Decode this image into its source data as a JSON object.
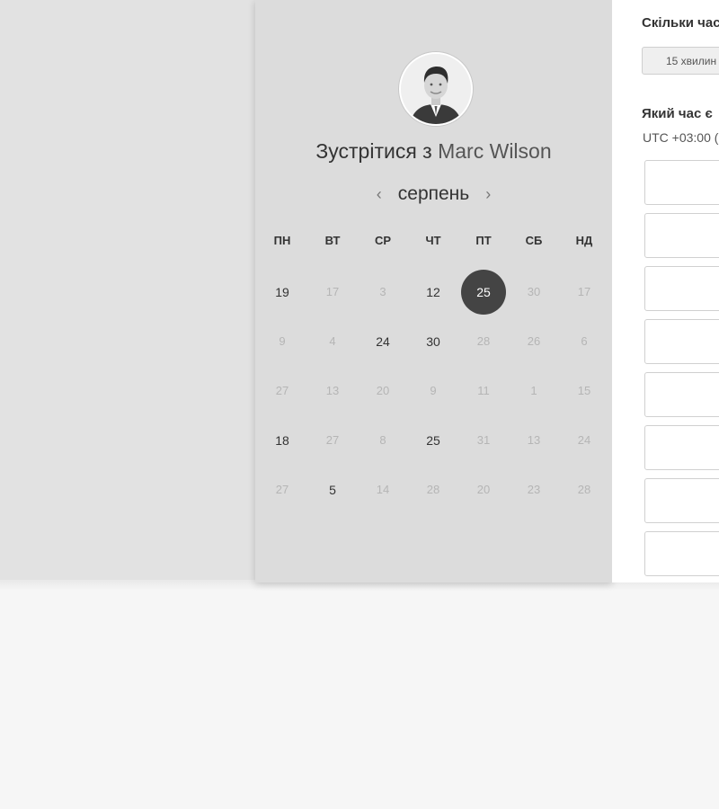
{
  "booking": {
    "title_prefix": "Зустрітися з",
    "host_name": "Marc Wilson",
    "avatar_icon": "person-photo",
    "month": "серпень",
    "prev_icon": "chevron-left-icon",
    "next_icon": "chevron-right-icon",
    "weekdays": [
      "ПН",
      "ВТ",
      "СР",
      "ЧТ",
      "ПТ",
      "СБ",
      "НД"
    ],
    "weeks": [
      [
        {
          "d": "19",
          "s": "active"
        },
        {
          "d": "17",
          "s": "inactive"
        },
        {
          "d": "3",
          "s": "inactive"
        },
        {
          "d": "12",
          "s": "active"
        },
        {
          "d": "25",
          "s": "selected"
        },
        {
          "d": "30",
          "s": "inactive"
        },
        {
          "d": "17",
          "s": "inactive"
        }
      ],
      [
        {
          "d": "9",
          "s": "inactive"
        },
        {
          "d": "4",
          "s": "inactive"
        },
        {
          "d": "24",
          "s": "active"
        },
        {
          "d": "30",
          "s": "active"
        },
        {
          "d": "28",
          "s": "inactive"
        },
        {
          "d": "26",
          "s": "inactive"
        },
        {
          "d": "6",
          "s": "inactive"
        }
      ],
      [
        {
          "d": "27",
          "s": "inactive"
        },
        {
          "d": "13",
          "s": "inactive"
        },
        {
          "d": "20",
          "s": "inactive"
        },
        {
          "d": "9",
          "s": "inactive"
        },
        {
          "d": "11",
          "s": "inactive"
        },
        {
          "d": "1",
          "s": "inactive"
        },
        {
          "d": "15",
          "s": "inactive"
        }
      ],
      [
        {
          "d": "18",
          "s": "active"
        },
        {
          "d": "27",
          "s": "inactive"
        },
        {
          "d": "8",
          "s": "inactive"
        },
        {
          "d": "25",
          "s": "active"
        },
        {
          "d": "31",
          "s": "inactive"
        },
        {
          "d": "13",
          "s": "inactive"
        },
        {
          "d": "24",
          "s": "inactive"
        }
      ],
      [
        {
          "d": "27",
          "s": "inactive"
        },
        {
          "d": "5",
          "s": "active"
        },
        {
          "d": "14",
          "s": "inactive"
        },
        {
          "d": "28",
          "s": "inactive"
        },
        {
          "d": "20",
          "s": "inactive"
        },
        {
          "d": "23",
          "s": "inactive"
        },
        {
          "d": "28",
          "s": "inactive"
        }
      ]
    ],
    "selected_color": "#444444"
  },
  "options": {
    "duration_heading": "Скільки час",
    "duration_value": "15 хвилин",
    "time_heading": "Який час є",
    "timezone": "UTC +03:00 (",
    "slot_count": 8
  }
}
